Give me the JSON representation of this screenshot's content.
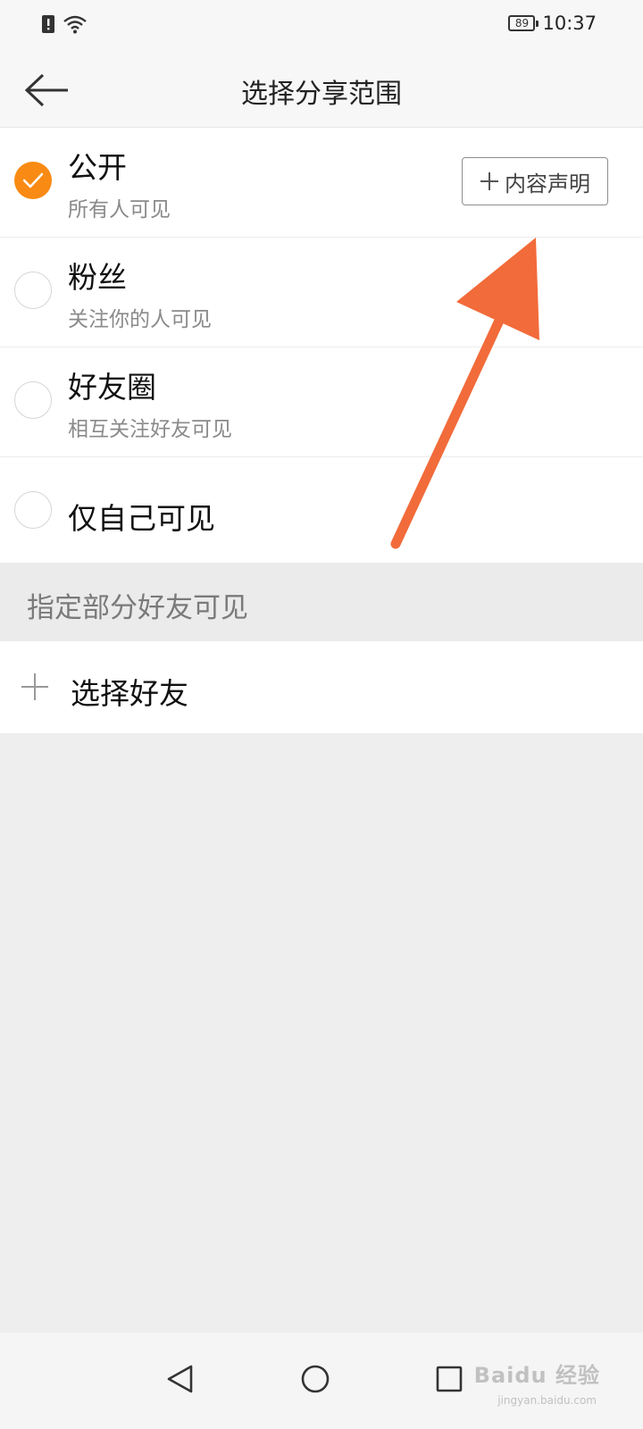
{
  "status_bar": {
    "battery": "89",
    "time": "10:37"
  },
  "header": {
    "title": "选择分享范围"
  },
  "options": [
    {
      "title": "公开",
      "subtitle": "所有人可见",
      "checked": true
    },
    {
      "title": "粉丝",
      "subtitle": "关注你的人可见",
      "checked": false
    },
    {
      "title": "好友圈",
      "subtitle": "相互关注好友可见",
      "checked": false
    },
    {
      "title": "仅自己可见",
      "subtitle": "",
      "checked": false
    }
  ],
  "content_declare_label": "内容声明",
  "section": {
    "title": "指定部分好友可见"
  },
  "choose_friends_label": "选择好友",
  "watermark": {
    "brand": "Baidu 经验",
    "url": "jingyan.baidu.com"
  },
  "colors": {
    "accent": "#f98a13",
    "annotation_arrow": "#f26b3a"
  }
}
